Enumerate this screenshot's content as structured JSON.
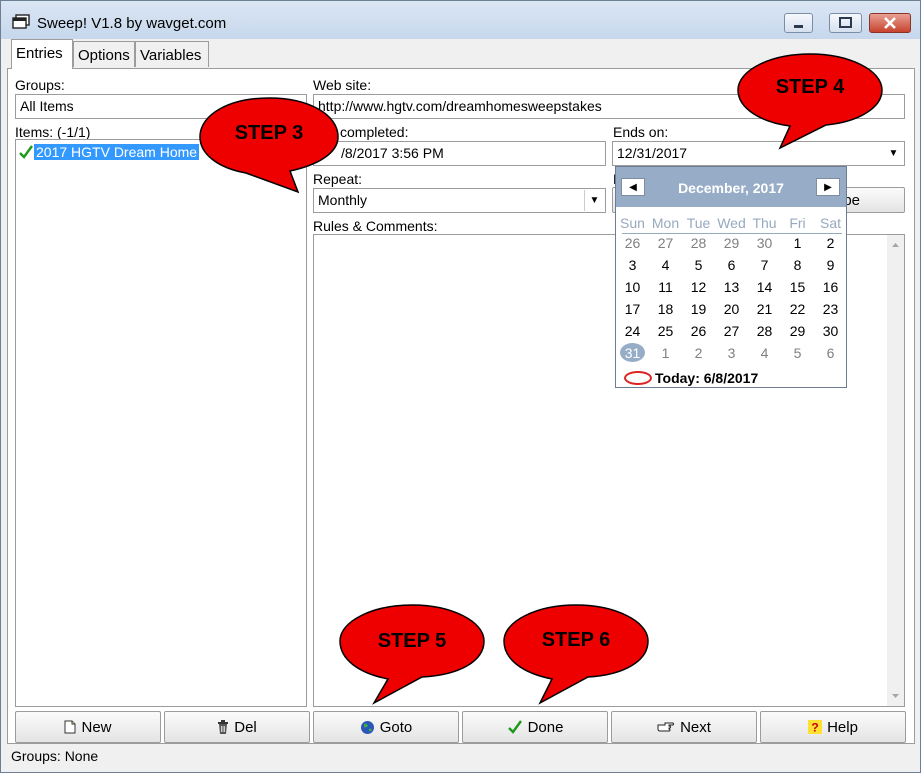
{
  "window": {
    "title": "Sweep! V1.8 by wavget.com"
  },
  "tabs": [
    "Entries",
    "Options",
    "Variables"
  ],
  "form": {
    "groups_label": "Groups:",
    "groups_value": "All Items",
    "items_label": "Items: (-1/1)",
    "items": [
      {
        "label": "2017 HGTV Dream Home",
        "checked": true
      }
    ],
    "website_label": "Web site:",
    "website_value": "http://www.hgtv.com/dreamhomesweepstakes",
    "last_completed_label": "completed:",
    "last_completed_value": "/8/2017 3:56 PM",
    "ends_on_label": "Ends on:",
    "ends_on_value": "12/31/2017",
    "repeat_label": "Repeat:",
    "repeat_value": "Monthly",
    "hidden_label_fragment": "E",
    "hidden_button_fragment": "pe",
    "rules_label": "Rules & Comments:"
  },
  "calendar": {
    "month": "December, 2017",
    "days_of_week": [
      "Sun",
      "Mon",
      "Tue",
      "Wed",
      "Thu",
      "Fri",
      "Sat"
    ],
    "weeks": [
      [
        "26",
        "27",
        "28",
        "29",
        "30",
        "1",
        "2"
      ],
      [
        "3",
        "4",
        "5",
        "6",
        "7",
        "8",
        "9"
      ],
      [
        "10",
        "11",
        "12",
        "13",
        "14",
        "15",
        "16"
      ],
      [
        "17",
        "18",
        "19",
        "20",
        "21",
        "22",
        "23"
      ],
      [
        "24",
        "25",
        "26",
        "27",
        "28",
        "29",
        "30"
      ],
      [
        "31",
        "1",
        "2",
        "3",
        "4",
        "5",
        "6"
      ]
    ],
    "selected": "31",
    "today_text": "Today: 6/8/2017"
  },
  "buttons": {
    "new": "New",
    "del": "Del",
    "goto": "Goto",
    "done": "Done",
    "next": "Next",
    "help": "Help"
  },
  "status": "Groups: None",
  "callouts": {
    "step3": "STEP 3",
    "step4": "STEP 4",
    "step5": "STEP 5",
    "step6": "STEP 6"
  },
  "colors": {
    "callout_fill": "#ee0000",
    "selection": "#3399ff",
    "calendar_header": "#97adc7"
  }
}
